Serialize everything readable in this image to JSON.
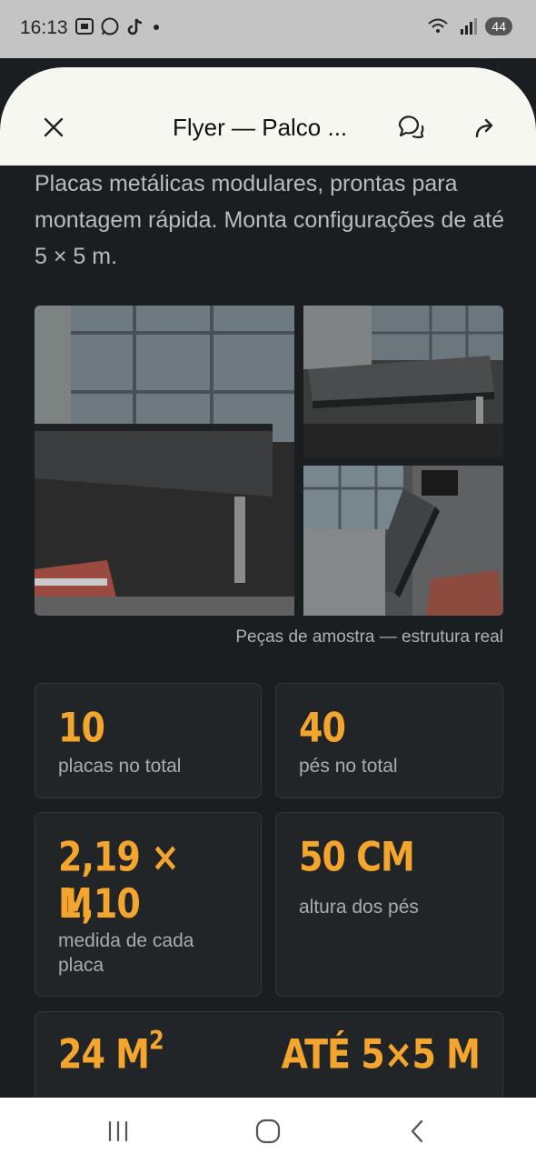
{
  "status": {
    "time": "16:13",
    "battery": "44"
  },
  "toolbar": {
    "title": "Flyer — Palco ..."
  },
  "content": {
    "intro": "Placas metálicas modulares, prontas para montagem rápida. Monta configurações de até 5 × 5 m.",
    "caption": "Peças de amostra — estrutura real",
    "stats": [
      {
        "value": "10",
        "label": "placas no total"
      },
      {
        "value": "40",
        "label": "pés no total"
      },
      {
        "value": "2,19 × 1,10",
        "value2": "M",
        "label": "medida de cada",
        "label2": "placa"
      },
      {
        "value": "50 CM",
        "label": "altura dos pés"
      }
    ],
    "summary": {
      "left_value": "24 M",
      "left_sup": "2",
      "right_value": "ATÉ 5×5 M"
    }
  },
  "icons": {
    "close": "close-icon",
    "comments": "comments-icon",
    "share": "share-icon",
    "nav_recents": "recents-icon",
    "nav_home": "home-icon",
    "nav_back": "back-icon"
  }
}
